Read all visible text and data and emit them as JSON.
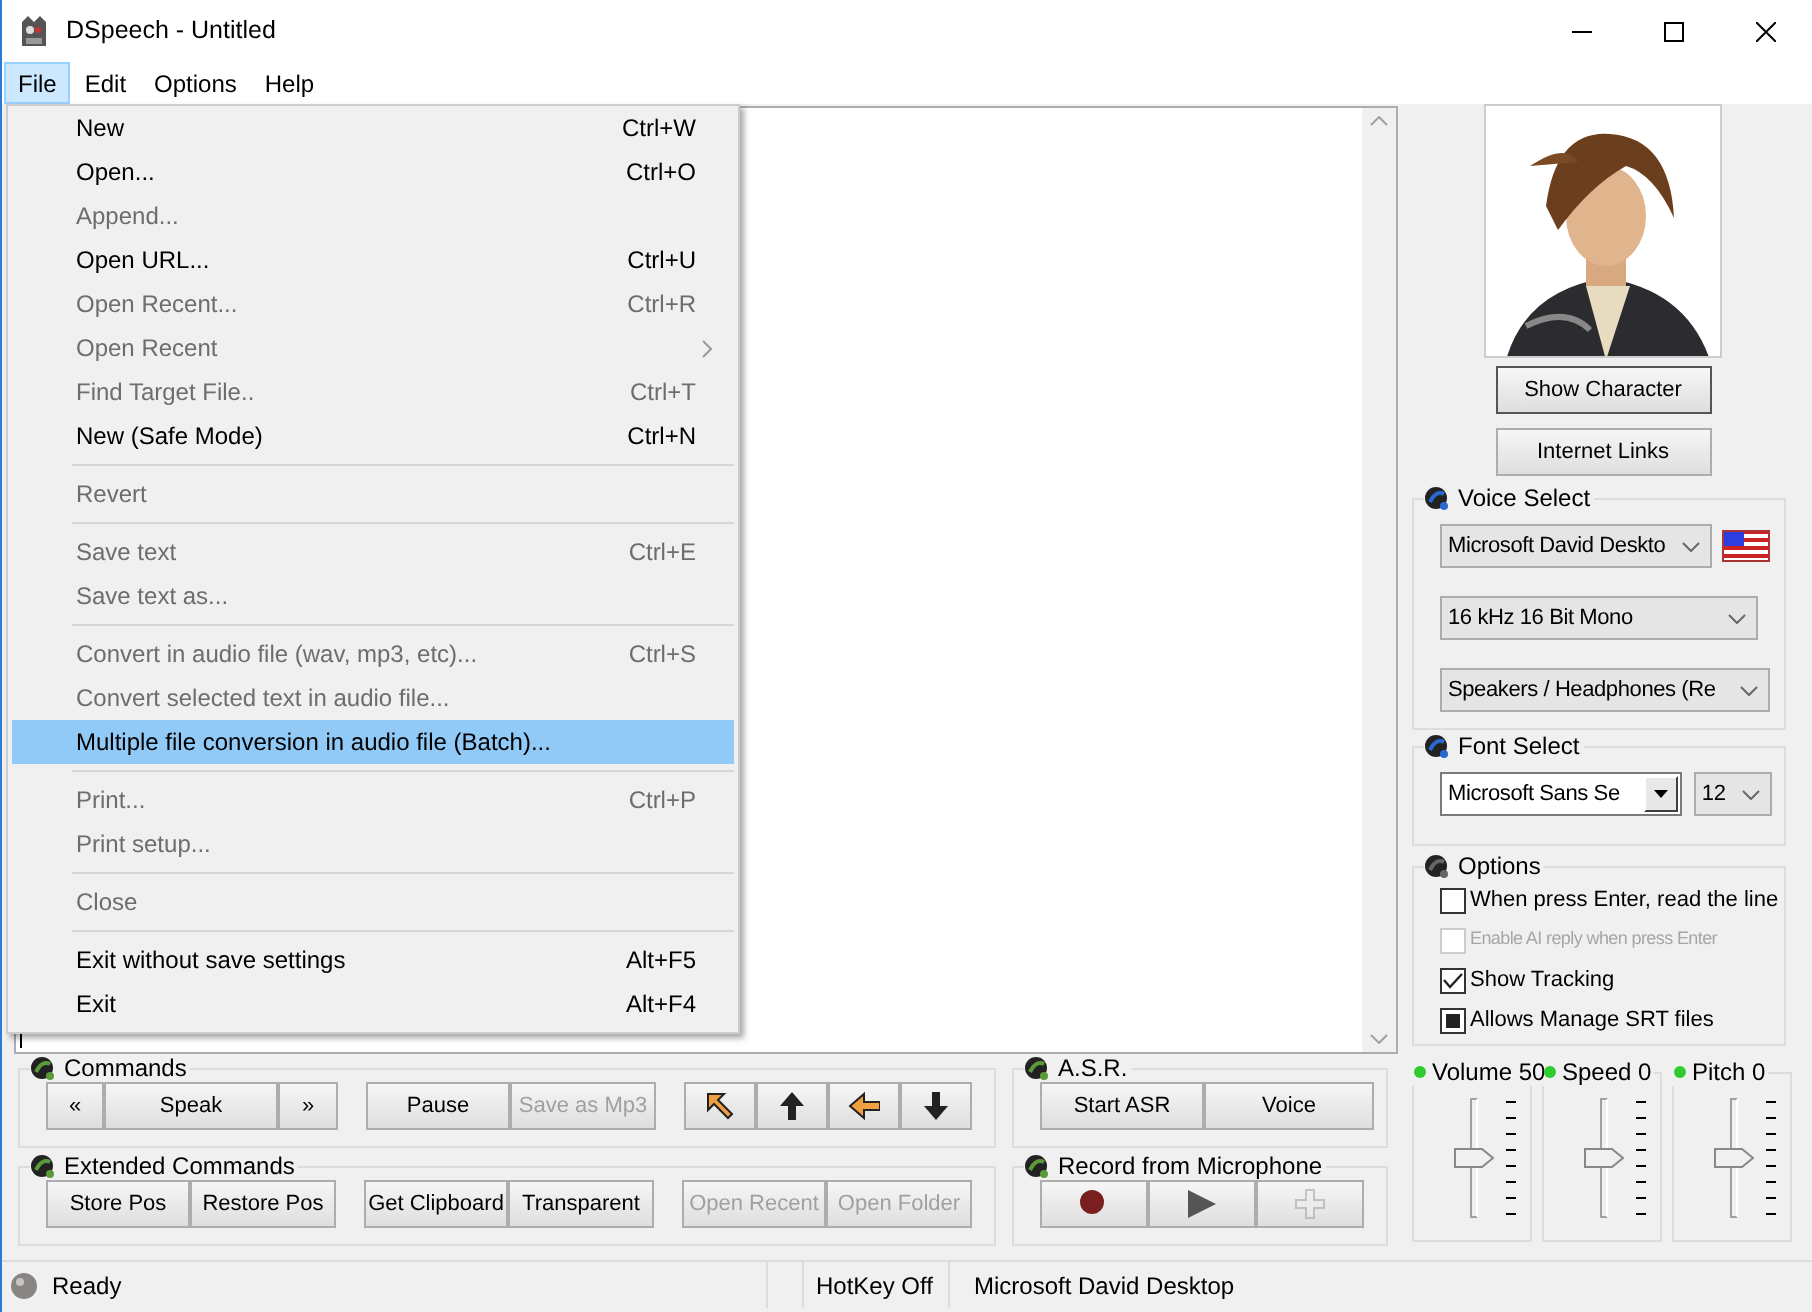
{
  "window": {
    "title": "DSpeech - Untitled"
  },
  "menubar": [
    {
      "label": "File",
      "selected": true
    },
    {
      "label": "Edit",
      "selected": false
    },
    {
      "label": "Options",
      "selected": false
    },
    {
      "label": "Help",
      "selected": false
    }
  ],
  "file_menu": [
    {
      "kind": "item",
      "label": "New",
      "shortcut": "Ctrl+W",
      "disabled": false,
      "submenu": false,
      "selected": false
    },
    {
      "kind": "item",
      "label": "Open...",
      "shortcut": "Ctrl+O",
      "disabled": false,
      "submenu": false,
      "selected": false
    },
    {
      "kind": "item",
      "label": "Append...",
      "disabled": true,
      "submenu": false,
      "selected": false
    },
    {
      "kind": "item",
      "label": "Open URL...",
      "shortcut": "Ctrl+U",
      "disabled": false,
      "submenu": false,
      "selected": false
    },
    {
      "kind": "item",
      "label": "Open Recent...",
      "shortcut": "Ctrl+R",
      "disabled": true,
      "submenu": false,
      "selected": false
    },
    {
      "kind": "item",
      "label": "Open Recent",
      "disabled": true,
      "submenu": true,
      "selected": false
    },
    {
      "kind": "item",
      "label": "Find Target File..",
      "shortcut": "Ctrl+T",
      "disabled": true,
      "submenu": false,
      "selected": false
    },
    {
      "kind": "item",
      "label": "New (Safe Mode)",
      "shortcut": "Ctrl+N",
      "disabled": false,
      "submenu": false,
      "selected": false
    },
    {
      "kind": "separator"
    },
    {
      "kind": "item",
      "label": "Revert",
      "disabled": true,
      "submenu": false,
      "selected": false
    },
    {
      "kind": "separator"
    },
    {
      "kind": "item",
      "label": "Save text",
      "shortcut": "Ctrl+E",
      "disabled": true,
      "submenu": false,
      "selected": false
    },
    {
      "kind": "item",
      "label": "Save text as...",
      "disabled": true,
      "submenu": false,
      "selected": false
    },
    {
      "kind": "separator"
    },
    {
      "kind": "item",
      "label": "Convert in audio file (wav, mp3, etc)...",
      "shortcut": "Ctrl+S",
      "disabled": true,
      "submenu": false,
      "selected": false
    },
    {
      "kind": "item",
      "label": "Convert selected text in audio file...",
      "disabled": true,
      "submenu": false,
      "selected": false
    },
    {
      "kind": "item",
      "label": "Multiple file conversion in audio file (Batch)...",
      "disabled": false,
      "submenu": false,
      "selected": true
    },
    {
      "kind": "separator"
    },
    {
      "kind": "item",
      "label": "Print...",
      "shortcut": "Ctrl+P",
      "disabled": true,
      "submenu": false,
      "selected": false
    },
    {
      "kind": "item",
      "label": "Print setup...",
      "disabled": true,
      "submenu": false,
      "selected": false
    },
    {
      "kind": "separator"
    },
    {
      "kind": "item",
      "label": "Close",
      "disabled": true,
      "submenu": false,
      "selected": false
    },
    {
      "kind": "separator"
    },
    {
      "kind": "item",
      "label": "Exit without save settings",
      "shortcut": "Alt+F5",
      "disabled": false,
      "submenu": false,
      "selected": false
    },
    {
      "kind": "item",
      "label": "Exit",
      "shortcut": "Alt+F4",
      "disabled": false,
      "submenu": false,
      "selected": false
    }
  ],
  "character": {
    "kind": "picture",
    "buttons": [
      "Show Character",
      "Internet Links"
    ]
  },
  "voice_select": {
    "title": "Voice Select",
    "voice": "Microsoft David Deskto",
    "format": "16 kHz 16 Bit Mono",
    "output": "Speakers / Headphones (Re"
  },
  "font_select": {
    "title": "Font Select",
    "font": "Microsoft Sans Se",
    "size": "12"
  },
  "options": {
    "title": "Options",
    "items": [
      {
        "kind": "tick",
        "label": "When press Enter, read the line",
        "checked": false,
        "disabled": false
      },
      {
        "kind": "tick",
        "label": "Enable AI reply when press Enter",
        "checked": false,
        "disabled": true
      },
      {
        "kind": "tick",
        "label": "Show Tracking",
        "checked": true,
        "disabled": false
      },
      {
        "kind": "square",
        "label": "Allows Manage SRT files",
        "checked": true,
        "disabled": false
      }
    ]
  },
  "sliders": [
    {
      "label": "Volume 50",
      "level": 0.5
    },
    {
      "label": "Speed 0",
      "level": 0.5
    },
    {
      "label": "Pitch 0",
      "level": 0.5
    }
  ],
  "commands": {
    "title": "Commands",
    "clusters": [
      [
        {
          "kind": "text",
          "label": "«",
          "disabled": false
        },
        {
          "kind": "text",
          "label": "Speak",
          "disabled": false
        },
        {
          "kind": "text",
          "label": "»",
          "disabled": false
        }
      ],
      [
        {
          "kind": "text",
          "label": "Pause",
          "disabled": false
        },
        {
          "kind": "text",
          "label": "Save as Mp3",
          "disabled": true
        }
      ],
      [
        {
          "kind": "northwest",
          "disabled": false
        },
        {
          "kind": "up",
          "disabled": false
        },
        {
          "kind": "left",
          "disabled": false
        },
        {
          "kind": "down",
          "disabled": false
        }
      ]
    ]
  },
  "extended_commands": {
    "title": "Extended Commands",
    "clusters": [
      [
        {
          "kind": "text",
          "label": "Store Pos",
          "disabled": false
        },
        {
          "kind": "text",
          "label": "Restore Pos",
          "disabled": false
        }
      ],
      [
        {
          "kind": "text",
          "label": "Get Clipboard",
          "disabled": false
        },
        {
          "kind": "text",
          "label": "Transparent",
          "disabled": false
        }
      ],
      [
        {
          "kind": "text",
          "label": "Open Recent",
          "disabled": true
        },
        {
          "kind": "text",
          "label": "Open Folder",
          "disabled": true
        }
      ]
    ]
  },
  "asr": {
    "title": "A.S.R.",
    "clusters": [
      [
        {
          "kind": "text",
          "label": "Start ASR",
          "disabled": false
        },
        {
          "kind": "text",
          "label": "Voice",
          "disabled": false
        }
      ]
    ]
  },
  "record": {
    "title": "Record from Microphone",
    "clusters": [
      [
        {
          "kind": "record",
          "disabled": false
        },
        {
          "kind": "play",
          "disabled": false
        },
        {
          "kind": "plus",
          "disabled": true
        }
      ]
    ]
  },
  "status_bar": {
    "status": "Ready",
    "hotkey": "HotKey Off",
    "voice": "Microsoft David Desktop"
  }
}
